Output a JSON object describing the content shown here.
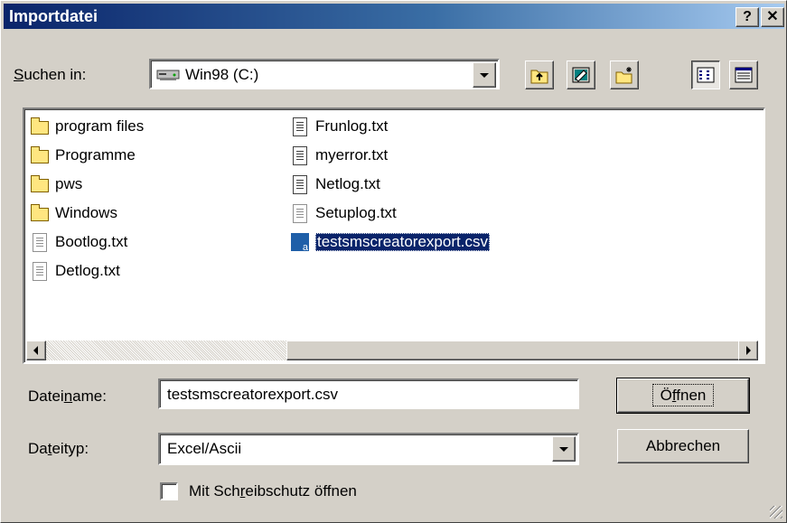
{
  "window": {
    "title": "Importdatei",
    "help_button": "?",
    "close_button": "✕"
  },
  "look_in": {
    "label_pre": "",
    "label_accel": "S",
    "label_post": "uchen in:",
    "value": "Win98 (C:)"
  },
  "toolbar": {
    "up_folder": "up-folder-icon",
    "desktop": "desktop-icon",
    "new_folder": "new-folder-icon",
    "list_view": "list-view-icon",
    "details_view": "details-view-icon"
  },
  "files": {
    "col1": [
      {
        "name": "program files",
        "type": "folder"
      },
      {
        "name": "Programme",
        "type": "folder"
      },
      {
        "name": "pws",
        "type": "folder"
      },
      {
        "name": "Windows",
        "type": "folder"
      },
      {
        "name": "Bootlog.txt",
        "type": "txt-grey"
      },
      {
        "name": "Detlog.txt",
        "type": "txt-grey"
      }
    ],
    "col2": [
      {
        "name": "Frunlog.txt",
        "type": "txt"
      },
      {
        "name": "myerror.txt",
        "type": "txt"
      },
      {
        "name": "Netlog.txt",
        "type": "txt"
      },
      {
        "name": "Setuplog.txt",
        "type": "txt-grey"
      },
      {
        "name": "testsmscreatorexport.csv",
        "type": "csv",
        "selected": true
      }
    ]
  },
  "filename": {
    "label_pre": "Datei",
    "label_accel": "n",
    "label_post": "ame:",
    "value": "testsmscreatorexport.csv"
  },
  "filetype": {
    "label_pre": "Da",
    "label_accel": "t",
    "label_post": "eityp:",
    "value": "Excel/Ascii"
  },
  "buttons": {
    "open_pre": "Ö",
    "open_accel": "f",
    "open_post": "fnen",
    "cancel": "Abbrechen"
  },
  "readonly": {
    "label_pre": "Mit Sch",
    "label_accel": "r",
    "label_post": "eibschutz öffnen",
    "checked": false
  }
}
